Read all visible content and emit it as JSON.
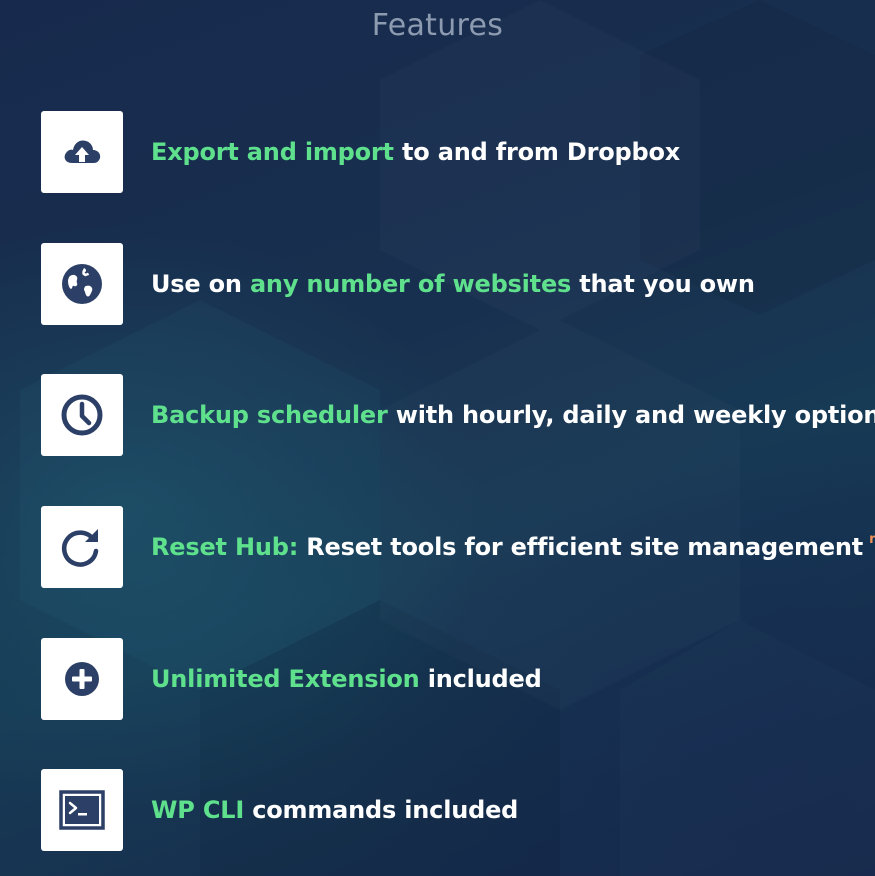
{
  "page": {
    "title": "Features"
  },
  "colors": {
    "background": "#17294a",
    "highlight": "#5fe08c",
    "text": "#ffffff",
    "title": "#8d9bb0",
    "icon": "#2c3f66",
    "badge": "#f0925a"
  },
  "features": [
    {
      "icon": "cloud-upload-icon",
      "pre": "",
      "highlight": "Export and import",
      "post": " to and from Dropbox",
      "badge": ""
    },
    {
      "icon": "globe-icon",
      "pre": "Use on ",
      "highlight": "any number of websites",
      "post": " that you own",
      "badge": ""
    },
    {
      "icon": "clock-icon",
      "pre": "",
      "highlight": "Backup scheduler",
      "post": " with hourly, daily and weekly options",
      "badge": ""
    },
    {
      "icon": "refresh-icon",
      "pre": "",
      "highlight": "Reset Hub:",
      "post": " Reset tools for efficient site management",
      "badge": "new"
    },
    {
      "icon": "plus-circle-icon",
      "pre": "",
      "highlight": "Unlimited Extension",
      "post": " included",
      "badge": ""
    },
    {
      "icon": "terminal-icon",
      "pre": "",
      "highlight": "WP CLI",
      "post": " commands included",
      "badge": ""
    }
  ]
}
